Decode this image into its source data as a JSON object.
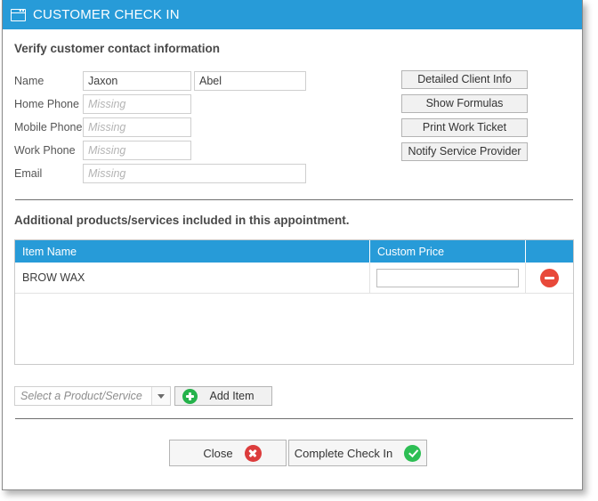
{
  "window": {
    "title": "CUSTOMER CHECK IN",
    "title_icon": "window-form-icon",
    "header_color": "#279BD8"
  },
  "verify_section": {
    "heading": "Verify customer contact information",
    "fields": [
      {
        "label": "Name",
        "value": "Jaxon",
        "placeholder": ""
      },
      {
        "label": "Home Phone",
        "value": "",
        "placeholder": "Missing"
      },
      {
        "label": "Mobile Phone",
        "value": "",
        "placeholder": "Missing"
      },
      {
        "label": "Work Phone",
        "value": "",
        "placeholder": "Missing"
      },
      {
        "label": "Email",
        "value": "",
        "placeholder": "Missing"
      }
    ],
    "last_name": {
      "value": "Abel",
      "placeholder": ""
    }
  },
  "action_buttons": [
    {
      "label": "Detailed Client Info"
    },
    {
      "label": "Show Formulas"
    },
    {
      "label": "Print Work Ticket"
    },
    {
      "label": "Notify Service Provider"
    }
  ],
  "additional_section": {
    "heading": "Additional products/services included in this appointment.",
    "table": {
      "columns": [
        "Item Name",
        "Custom Price",
        ""
      ],
      "rows": [
        {
          "item_name": "BROW WAX",
          "custom_price": "",
          "remove_icon": "remove-circle-icon"
        }
      ]
    },
    "product_select": {
      "placeholder": "Select a Product/Service",
      "arrow_icon": "chevron-down-icon"
    },
    "add_item_button": {
      "label": "Add Item",
      "icon": "plus-circle-icon"
    }
  },
  "footer": {
    "close_button": {
      "label": "Close",
      "icon": "x-circle-icon"
    },
    "complete_button": {
      "label": "Complete Check In",
      "icon": "check-circle-icon"
    }
  },
  "colors": {
    "accent_blue": "#279BD8",
    "danger_red": "#DC3C3C",
    "remove_red": "#E8493A",
    "success_green": "#2DBE54",
    "add_green": "#25B24B"
  }
}
